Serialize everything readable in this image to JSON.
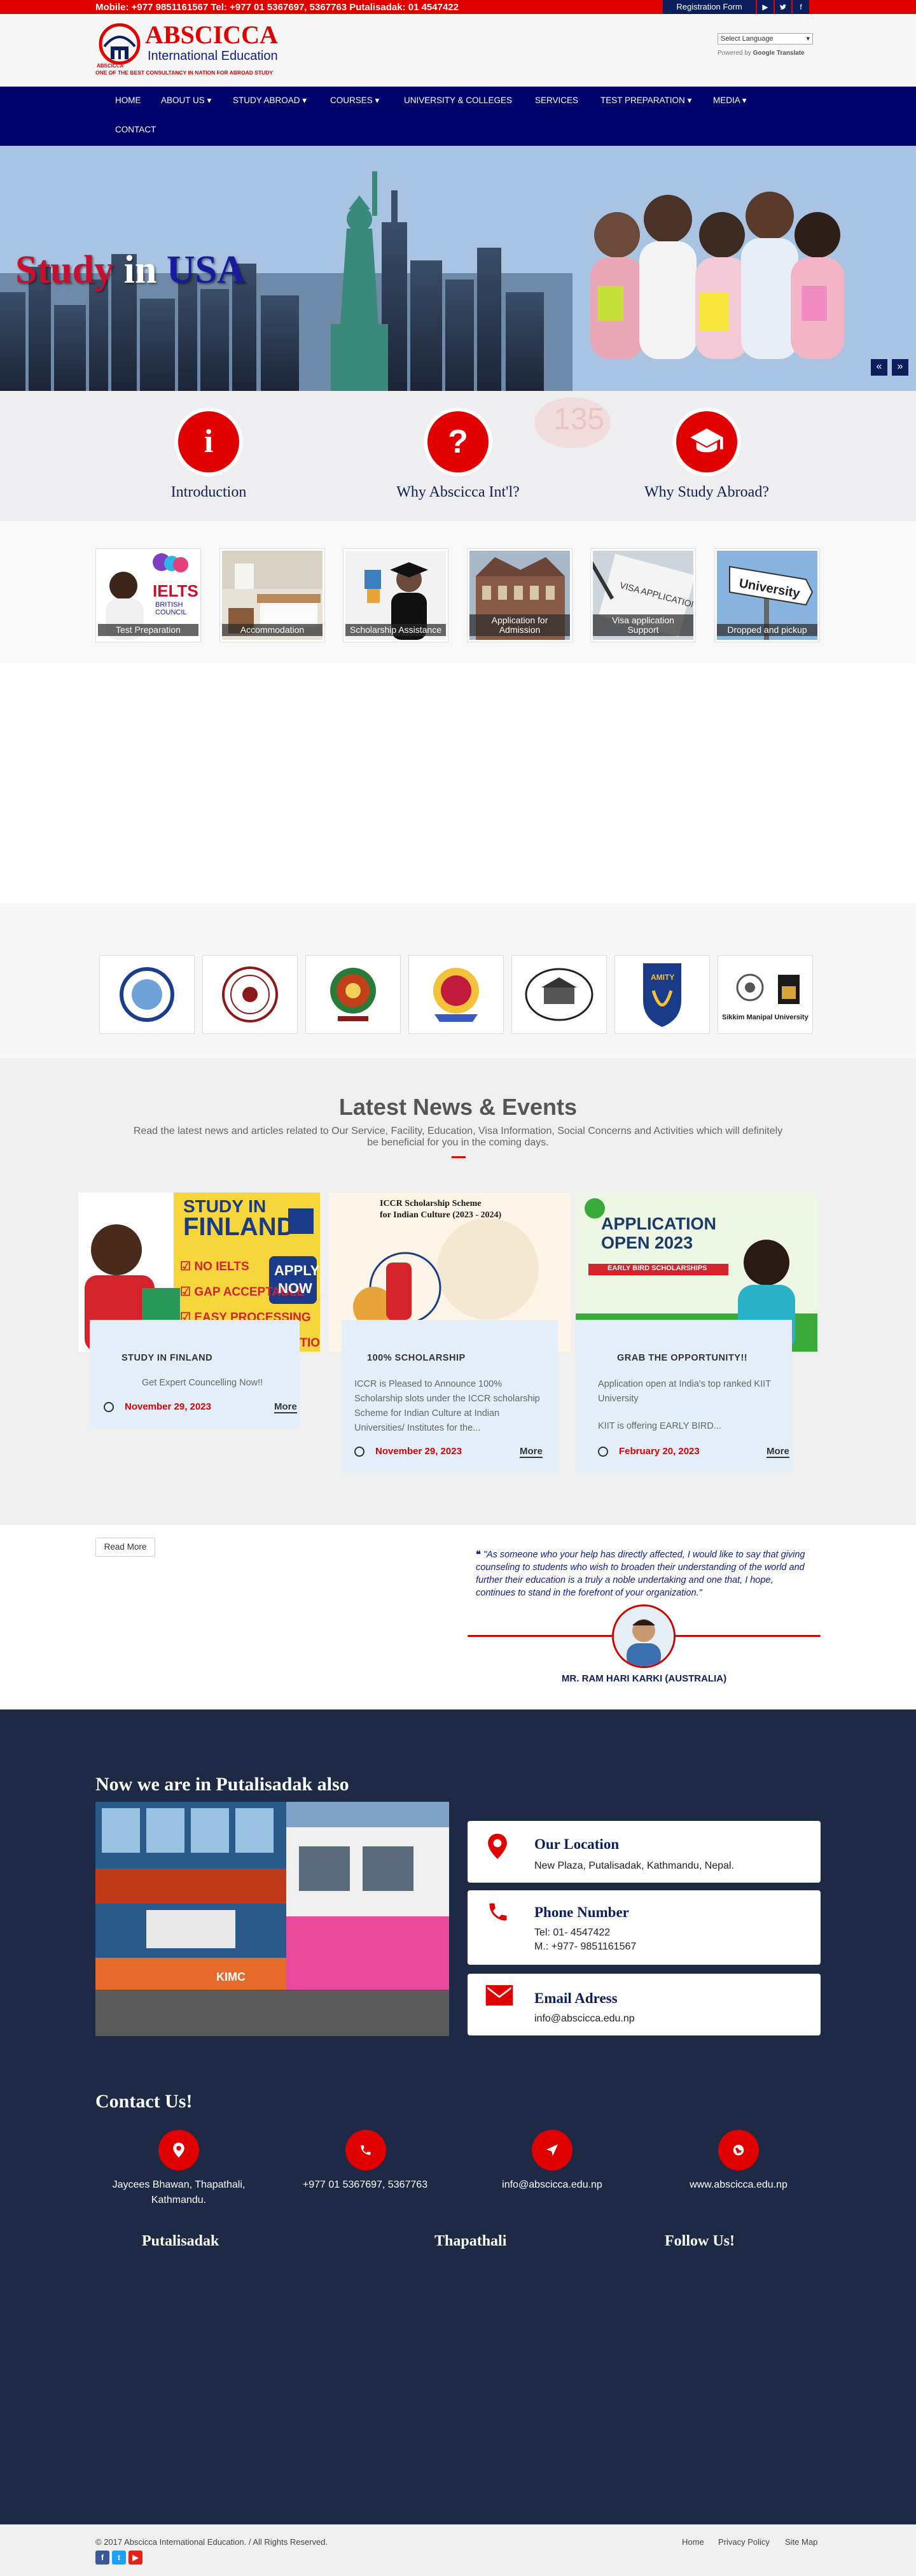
{
  "topbar": {
    "contact": "Mobile: +977 9851161567   Tel: +977 01 5367697, 5367763   Putalisadak:  01 4547422",
    "register_label": "Registration Form",
    "social_icons": [
      "youtube-icon",
      "twitter-icon",
      "facebook-icon"
    ]
  },
  "header": {
    "brand_name": "ABSCICCA",
    "brand_sub": "International Education",
    "tagline": "ONE OF THE BEST CONSULTANCY IN NATION FOR ABROAD STUDY",
    "logo_small": "ABSCICCA",
    "language_select": "Select Language",
    "powered_by": "Powered by",
    "translate": "Google Translate"
  },
  "nav": {
    "items": [
      "HOME",
      "ABOUT US",
      "STUDY ABROAD",
      "COURSES",
      "UNIVERSITY & COLLEGES",
      "SERVICES",
      "TEST PREPARATION",
      "MEDIA",
      "CONTACT"
    ]
  },
  "hero": {
    "word1": "Study",
    "word2": "in",
    "word3": "USA",
    "prev": "«",
    "next": "»"
  },
  "features": [
    {
      "label": "Introduction",
      "icon": "info-icon"
    },
    {
      "label": "Why Abscicca Int'l?",
      "icon": "question-icon"
    },
    {
      "label": "Why Study Abroad?",
      "icon": "graduation-cap-icon"
    }
  ],
  "services": [
    "Test Preparation",
    "Accommodation",
    "Scholarship Assistance",
    "Application for Admission",
    "Visa application Support",
    "Dropped and pickup"
  ],
  "partners": [
    "partner-university-logo-1",
    "partner-university-logo-2",
    "partner-university-logo-3",
    "partner-university-logo-4",
    "partner-university-logo-5",
    "AMITY",
    "Sikkim Manipal University"
  ],
  "news": {
    "heading": "Latest News & Events",
    "subheading": "Read the latest news and articles related to Our Service, Facility, Education, Visa Information, Social Concerns and Activities which will definitely be beneficial for you in the coming days.",
    "cards": [
      {
        "title": "STUDY IN FINLAND",
        "desc": "Get Expert Councelling Now!!",
        "date": "November 29, 2023",
        "more": "More",
        "image_text": [
          "STUDY IN",
          "FINLAND",
          "NO IELTS",
          "GAP ACCEPTABLE",
          "EASY PROCESSING",
          "AFFORDABLE TUITION FEE",
          "APPLY",
          "NOW"
        ]
      },
      {
        "title": "100% SCHOLARSHIP",
        "desc": "ICCR is Pleased to Announce 100% Scholarship slots under the ICCR scholarship Scheme for Indian Culture at Indian Universities/ Institutes for the...",
        "date": "November 29, 2023",
        "more": "More",
        "image_text": [
          "ICCR Scholarship Scheme",
          "for Indian Culture (2023 - 2024)"
        ]
      },
      {
        "title": "GRAB THE OPPORTUNITY!!",
        "desc1": "Application open at India's top ranked KIIT University",
        "desc2": "KIIT is offering EARLY BIRD...",
        "date": "February 20, 2023",
        "more": "More",
        "image_text": [
          "APPLICATION",
          "OPEN 2023",
          "EARLY BIRD SCHOLARSHIPS"
        ]
      }
    ],
    "read_more": "Read More"
  },
  "testimonial": {
    "quote": "\"As someone who your help has directly affected, I would like to say that giving counseling to students who wish to broaden their understanding of the world and further their education is a truly a noble undertaking and one that, I hope, continues to stand in the forefront of your organization.\"",
    "name": "MR. RAM HARI KARKI (AUSTRALIA)"
  },
  "footer": {
    "branch_title": "Now we are in Putalisadak also",
    "building_sign": "KIMC",
    "location_title": "Our Location",
    "location_value": "New Plaza, Putalisadak, Kathmandu, Nepal.",
    "phone_title": "Phone Number",
    "phone_value1": "Tel: 01- 4547422",
    "phone_value2": "M.: +977- 9851161567",
    "email_title": "Email Adress",
    "email_value": "info@abscicca.edu.np",
    "contact_title": "Contact Us!",
    "contacts": [
      {
        "icon": "map-pin-icon",
        "text": "Jaycees Bhawan, Thapathali, Kathmandu."
      },
      {
        "icon": "phone-icon",
        "text": "+977 01 5367697, 5367763"
      },
      {
        "icon": "paper-plane-icon",
        "text": "info@abscicca.edu.np"
      },
      {
        "icon": "globe-icon",
        "text": "www.abscicca.edu.np"
      }
    ],
    "col1": "Putalisadak",
    "col2": "Thapathali",
    "col3": "Follow Us!"
  },
  "bottom": {
    "copyright": "© 2017 Abscicca International Education. / All Rights Reserved.",
    "links": [
      "Home",
      "Privacy Policy",
      "Site Map"
    ],
    "social": [
      "f",
      "t",
      "▶"
    ]
  },
  "colors": {
    "brand_red": "#e00000",
    "navy": "#00006a",
    "footer_bg": "#1e2a45"
  }
}
